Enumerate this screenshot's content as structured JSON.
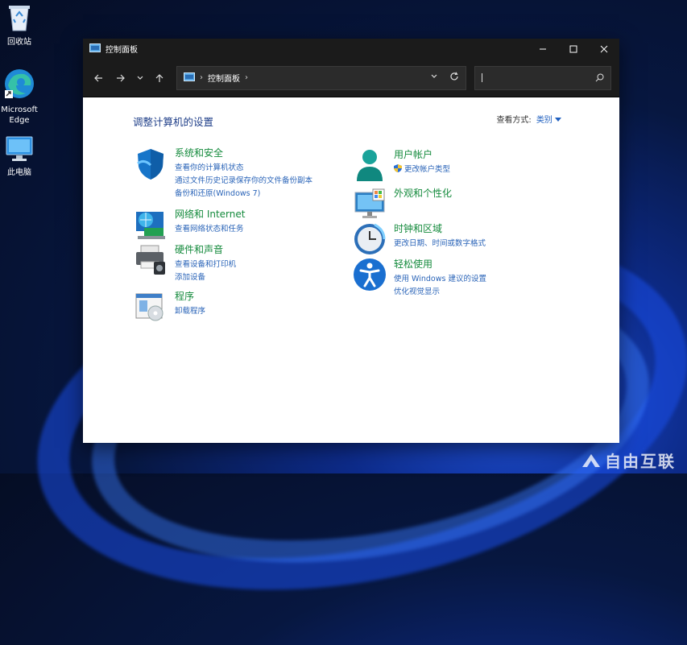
{
  "desktop": {
    "icons": [
      {
        "label": "回收站",
        "icon": "recycle-bin-icon"
      },
      {
        "label": "Microsoft Edge",
        "icon": "edge-icon"
      },
      {
        "label": "此电脑",
        "icon": "computer-icon"
      }
    ]
  },
  "window": {
    "title": "控制面板",
    "address": {
      "path": "控制面板"
    },
    "search": {
      "value": "",
      "placeholder": ""
    }
  },
  "content": {
    "heading": "调整计算机的设置",
    "view_by_label": "查看方式:",
    "view_by_value": "类别",
    "categories_left": [
      {
        "title": "系统和安全",
        "icon": "shield-icon",
        "links": [
          "查看你的计算机状态",
          "通过文件历史记录保存你的文件备份副本",
          "备份和还原(Windows 7)"
        ]
      },
      {
        "title": "网络和 Internet",
        "icon": "network-icon",
        "links": [
          "查看网络状态和任务"
        ]
      },
      {
        "title": "硬件和声音",
        "icon": "printer-icon",
        "links": [
          "查看设备和打印机",
          "添加设备"
        ]
      },
      {
        "title": "程序",
        "icon": "programs-icon",
        "links": [
          "卸载程序"
        ]
      }
    ],
    "categories_right": [
      {
        "title": "用户帐户",
        "icon": "user-icon",
        "links": [
          "更改帐户类型"
        ]
      },
      {
        "title": "外观和个性化",
        "icon": "appearance-icon",
        "links": []
      },
      {
        "title": "时钟和区域",
        "icon": "clock-icon",
        "links": [
          "更改日期、时间或数字格式"
        ]
      },
      {
        "title": "轻松使用",
        "icon": "accessibility-icon",
        "links": [
          "使用 Windows 建议的设置",
          "优化视觉显示"
        ]
      }
    ]
  },
  "watermark": {
    "text": "自由互联"
  }
}
